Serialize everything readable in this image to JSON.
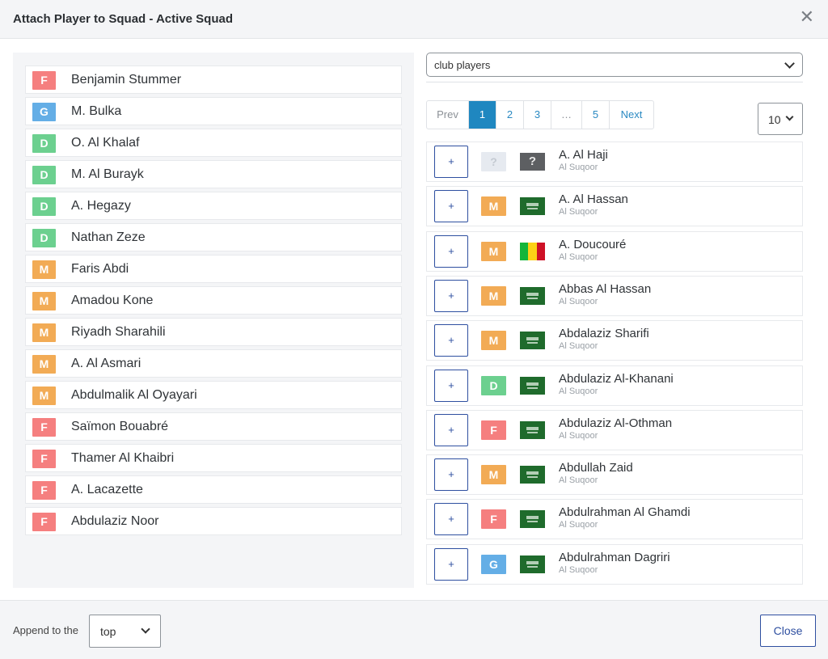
{
  "dialog": {
    "title": "Attach Player to Squad - Active Squad",
    "close_icon": "close-icon"
  },
  "colors": {
    "F": "#f57f7f",
    "G": "#64aee6",
    "D": "#6cd08f",
    "M": "#f2ab55",
    "accent": "#1f87c0",
    "button_border": "#2e4fa0"
  },
  "squad": [
    {
      "pos": "F",
      "name": "Benjamin Stummer"
    },
    {
      "pos": "G",
      "name": "M. Bulka"
    },
    {
      "pos": "D",
      "name": "O. Al Khalaf"
    },
    {
      "pos": "D",
      "name": "M. Al Burayk"
    },
    {
      "pos": "D",
      "name": "A. Hegazy"
    },
    {
      "pos": "D",
      "name": "Nathan Zeze"
    },
    {
      "pos": "M",
      "name": "Faris Abdi"
    },
    {
      "pos": "M",
      "name": "Amadou Kone"
    },
    {
      "pos": "M",
      "name": "Riyadh Sharahili"
    },
    {
      "pos": "M",
      "name": "A. Al Asmari"
    },
    {
      "pos": "M",
      "name": "Abdulmalik Al Oyayari"
    },
    {
      "pos": "F",
      "name": "Saïmon Bouabré"
    },
    {
      "pos": "F",
      "name": "Thamer Al Khaibri"
    },
    {
      "pos": "F",
      "name": "A. Lacazette"
    },
    {
      "pos": "F",
      "name": "Abdulaziz Noor"
    }
  ],
  "source_select": {
    "value": "club players"
  },
  "pagination": {
    "prev": "Prev",
    "pages": [
      "1",
      "2",
      "3",
      "…",
      "5"
    ],
    "active": "1",
    "next": "Next"
  },
  "per_page": {
    "value": "10"
  },
  "club_players": [
    {
      "add": "+",
      "pos": "?",
      "flag": "unknown",
      "name": "A. Al Haji",
      "club": "Al Suqoor"
    },
    {
      "add": "+",
      "pos": "M",
      "flag": "saudi-arabia",
      "name": "A. Al Hassan",
      "club": "Al Suqoor"
    },
    {
      "add": "+",
      "pos": "M",
      "flag": "mali",
      "name": "A. Doucouré",
      "club": "Al Suqoor"
    },
    {
      "add": "+",
      "pos": "M",
      "flag": "saudi-arabia",
      "name": "Abbas Al Hassan",
      "club": "Al Suqoor"
    },
    {
      "add": "+",
      "pos": "M",
      "flag": "saudi-arabia",
      "name": "Abdalaziz Sharifi",
      "club": "Al Suqoor"
    },
    {
      "add": "+",
      "pos": "D",
      "flag": "saudi-arabia",
      "name": "Abdulaziz Al-Khanani",
      "club": "Al Suqoor"
    },
    {
      "add": "+",
      "pos": "F",
      "flag": "saudi-arabia",
      "name": "Abdulaziz Al-Othman",
      "club": "Al Suqoor"
    },
    {
      "add": "+",
      "pos": "M",
      "flag": "saudi-arabia",
      "name": "Abdullah Zaid",
      "club": "Al Suqoor"
    },
    {
      "add": "+",
      "pos": "F",
      "flag": "saudi-arabia",
      "name": "Abdulrahman Al Ghamdi",
      "club": "Al Suqoor"
    },
    {
      "add": "+",
      "pos": "G",
      "flag": "saudi-arabia",
      "name": "Abdulrahman Dagriri",
      "club": "Al Suqoor"
    }
  ],
  "footer": {
    "append_label": "Append to the",
    "append_value": "top",
    "close_label": "Close"
  }
}
